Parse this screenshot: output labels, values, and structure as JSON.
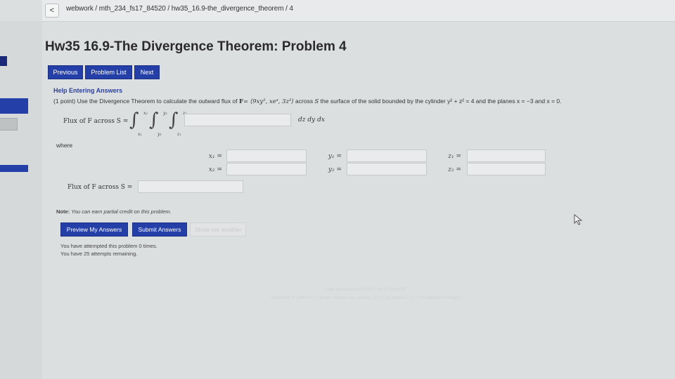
{
  "breadcrumb": {
    "back": "<",
    "path": "webwork / mth_234_fs17_84520 / hw35_16.9-the_divergence_theorem / 4"
  },
  "title": "Hw35 16.9-The Divergence Theorem: Problem 4",
  "nav": {
    "previous": "Previous",
    "list": "Problem List",
    "next": "Next"
  },
  "help_link": "Help Entering Answers",
  "problem": {
    "points": "(1 point)",
    "prefix": "Use the Divergence Theorem to calculate the outward flux of",
    "field_sym": "F",
    "field": "= ⟨9xy², xeᶻ, 3z³⟩",
    "across": "across",
    "surface": "S",
    "rest": "the surface of the solid bounded by the cylinder y² + z² = 4 and the planes x = −3 and x = 0."
  },
  "flux_label": "Flux of F across S =",
  "integrals": [
    {
      "upper": "z₂",
      "lower": "z₁"
    },
    {
      "upper": "y₂",
      "lower": "y₁"
    },
    {
      "upper": "x₂",
      "lower": "x₁"
    }
  ],
  "differentials": "dz dy dx",
  "where": "where",
  "bounds": [
    {
      "label": "x₁ =",
      "value": ""
    },
    {
      "label": "y₁ =",
      "value": ""
    },
    {
      "label": "z₁ =",
      "value": ""
    },
    {
      "label": "x₂ =",
      "value": ""
    },
    {
      "label": "y₂ =",
      "value": ""
    },
    {
      "label": "z₂ =",
      "value": ""
    }
  ],
  "flux_final_label": "Flux of F across S =",
  "note_label": "Note:",
  "note_text": "You can earn partial credit on this problem.",
  "buttons": {
    "preview": "Preview My Answers",
    "submit": "Submit Answers",
    "show_another": "Show me another"
  },
  "attempts": [
    "You have attempted this problem 0 times.",
    "You have 25 attempts remaining."
  ],
  "footer": [
    "Page generated at 12/06/17 at 3:17pm EST",
    "WeBWorK © 1996-2017 | theme: math4 | ww_version: 2.12 | pg_version 2.12 | The WeBWorK Project"
  ],
  "colors": {
    "accent": "#243fa8",
    "background": "#dcdfe0"
  }
}
